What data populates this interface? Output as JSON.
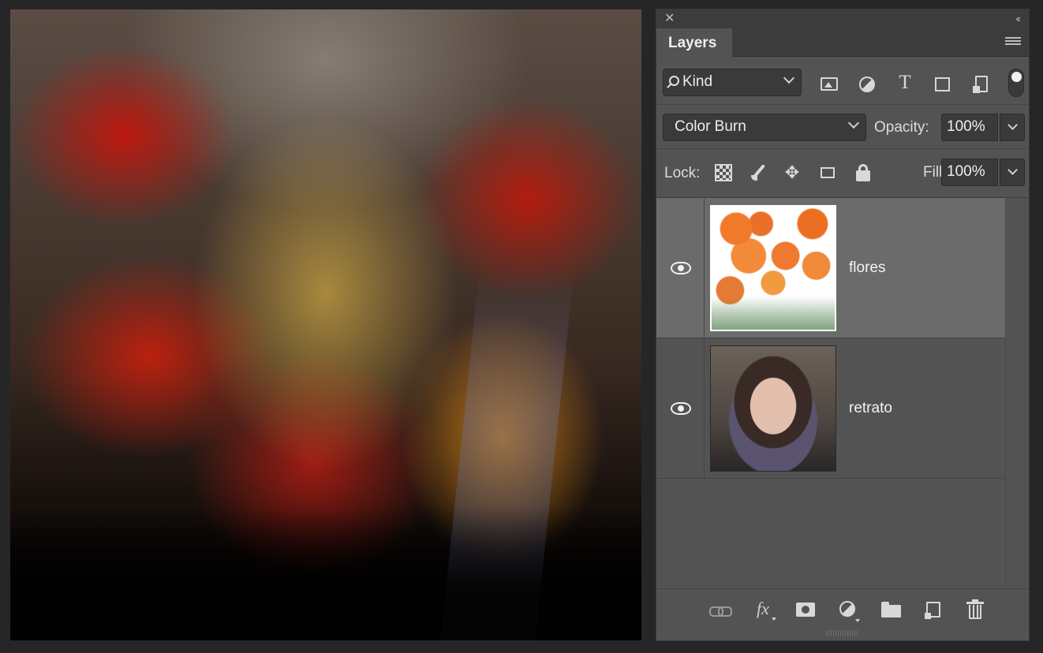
{
  "canvas": {
    "description_icon": "photo-canvas"
  },
  "panel": {
    "tab_title": "Layers",
    "filter": {
      "kind_label": "Kind",
      "icons": [
        "image-filter-icon",
        "adjustment-filter-icon",
        "type-filter-icon",
        "shape-filter-icon",
        "smart-object-filter-icon"
      ]
    },
    "blend": {
      "mode": "Color Burn",
      "opacity_label": "Opacity:",
      "opacity_value": "100%"
    },
    "lock": {
      "label": "Lock:",
      "fill_label": "Fill:",
      "fill_value": "100%"
    },
    "layers": [
      {
        "name": "flores",
        "visible": true,
        "selected": true
      },
      {
        "name": "retrato",
        "visible": true,
        "selected": false
      }
    ],
    "type_icon_glyph": "T",
    "move_icon_glyph": "✥",
    "fx_label": "fx"
  },
  "colors": {
    "panel_bg": "#535353",
    "selected_row": "#6b6b6b",
    "app_bg": "#262626"
  }
}
